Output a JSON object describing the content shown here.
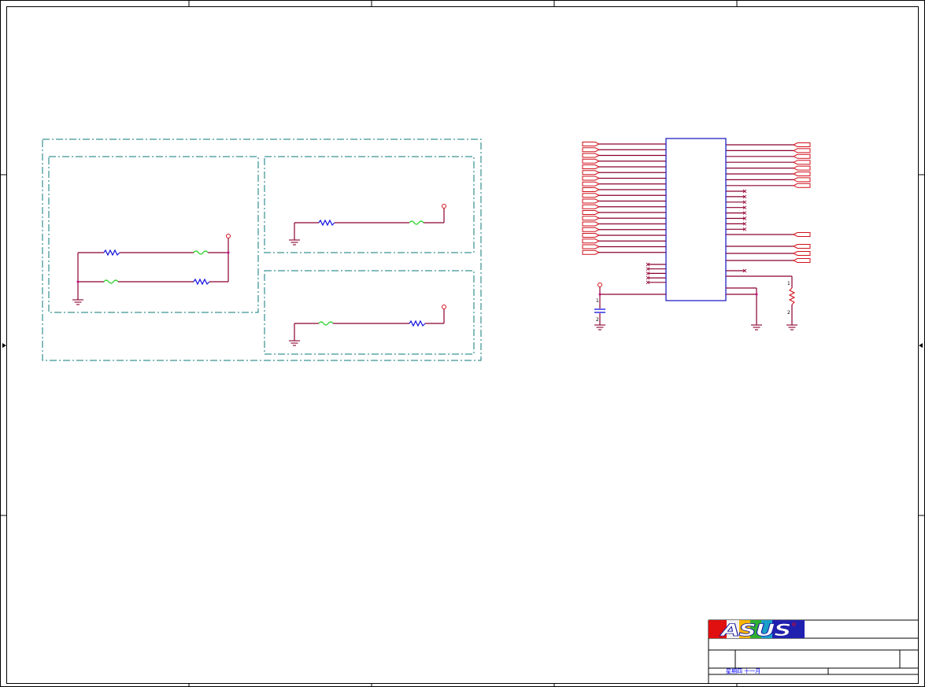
{
  "title_block": {
    "logo_text": "ASUS",
    "registered_mark": "®",
    "date_text": "星期四 十一月"
  },
  "colors": {
    "frame": "#000000",
    "group_border": "#0b7a7a",
    "wire": "#8a0030",
    "resistor": "#1010e0",
    "ferrite_bead": "#2ad02a",
    "power_and_ports": "#d0101a",
    "ic_outline": "#1010c0",
    "logo_red": "#e01010",
    "logo_blue": "#2020b0"
  },
  "pins": {
    "capacitor_top": "1",
    "capacitor_bottom": "2",
    "pulldown_top": "1",
    "pulldown_bottom": "2"
  },
  "connector_ports": {
    "left_count": 20,
    "right_upper_count": 8,
    "right_single_count": 1,
    "right_lower_count": 3
  }
}
